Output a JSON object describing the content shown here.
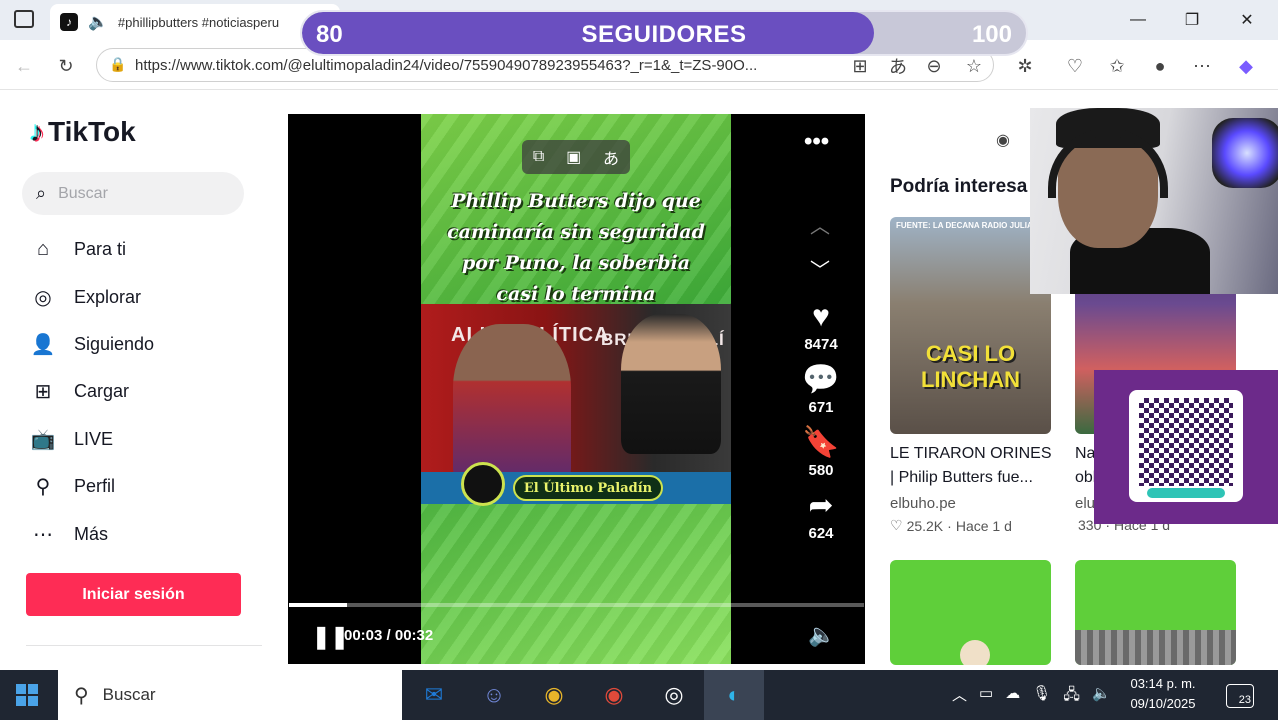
{
  "browser": {
    "tab_title": "#phillipbutters #noticiasperu",
    "url": "https://www.tiktok.com/@elultimopaladin24/video/7559049078923955463?_r=1&_t=ZS-90O..."
  },
  "followers_overlay": {
    "min": "80",
    "label": "SEGUIDORES",
    "max": "100",
    "progress_fraction": 0.79
  },
  "sidebar": {
    "logo": "TikTok",
    "search_placeholder": "Buscar",
    "items": [
      {
        "label": "Para ti",
        "icon": "home-icon"
      },
      {
        "label": "Explorar",
        "icon": "compass-icon"
      },
      {
        "label": "Siguiendo",
        "icon": "user-follow-icon"
      },
      {
        "label": "Cargar",
        "icon": "plus-square-icon"
      },
      {
        "label": "LIVE",
        "icon": "tv-icon"
      },
      {
        "label": "Perfil",
        "icon": "person-icon"
      },
      {
        "label": "Más",
        "icon": "more-dots-icon"
      }
    ],
    "login_label": "Iniciar sesión"
  },
  "video": {
    "caption": "Phillip Butters dijo que caminaría sin seguridad por Puno, la soberbia casi lo termina sepultando",
    "scene_text_left": "ALIDAD LÍTICA",
    "scene_text_right": "BRUTAL POLÍ",
    "banner": "El Último Paladín",
    "likes": "8474",
    "comments": "671",
    "saves": "580",
    "shares": "624",
    "time": "00:03 / 00:32",
    "progress_fraction": 0.1
  },
  "suggestions": {
    "title": "Podría interesa",
    "cards": [
      {
        "thumb_text": "CASI LO LINCHAN",
        "thumb_top": "FUENTE: LA DECANA RADIO JULIACA",
        "title": "LE TIRARON ORINES | Philip Butters fue...",
        "source": "elbuho.pe",
        "likes": "25.2K",
        "age": "Hace 1 d"
      },
      {
        "title": "Na... obl...",
        "source": "elu...",
        "likes": "330",
        "age": "Hace 1 d"
      }
    ]
  },
  "taskbar": {
    "search_placeholder": "Buscar",
    "time": "03:14 p. m.",
    "date": "09/10/2025",
    "notifications": "23"
  }
}
